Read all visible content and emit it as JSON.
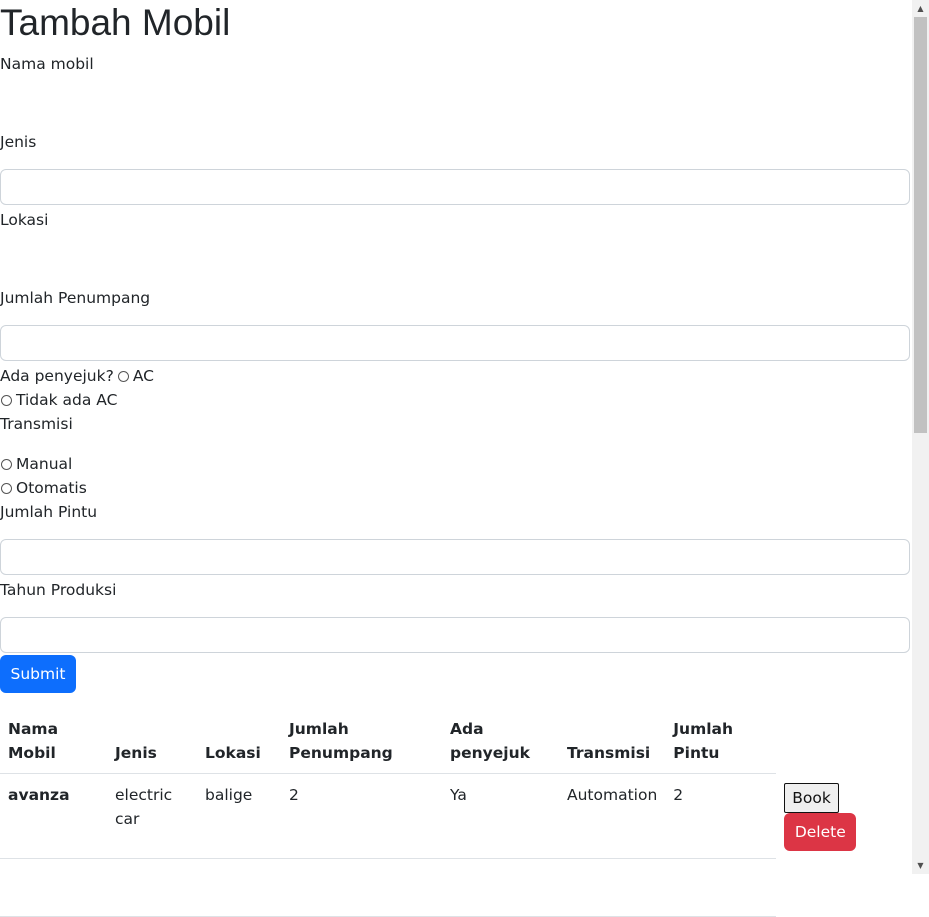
{
  "page": {
    "title": "Tambah Mobil"
  },
  "form": {
    "nama_label": "Nama mobil",
    "jenis_label": "Jenis",
    "lokasi_label": "Lokasi",
    "penumpang_label": "Jumlah Penumpang",
    "ac_label": "Ada penyejuk?",
    "ac_option_yes": "AC",
    "ac_option_no": "Tidak ada AC",
    "transmisi_label": "Transmisi",
    "trans_manual": "Manual",
    "trans_otomatis": "Otomatis",
    "pintu_label": "Jumlah Pintu",
    "tahun_label": "Tahun Produksi",
    "submit_label": "Submit"
  },
  "table": {
    "headers": {
      "nama_1": "Nama",
      "nama_2": "Mobil",
      "jenis": "Jenis",
      "lokasi": "Lokasi",
      "penumpang_1": "Jumlah",
      "penumpang_2": "Penumpang",
      "ac_1": "Ada",
      "ac_2": "penyejuk",
      "transmisi": "Transmisi",
      "pintu_1": "Jumlah",
      "pintu_2": "Pintu"
    },
    "rows": [
      {
        "nama": "avanza",
        "jenis_1": "electric",
        "jenis_2": "car",
        "lokasi": "balige",
        "penumpang": "2",
        "ac": "Ya",
        "transmisi": "Automation",
        "pintu": "2",
        "book_label": "Book",
        "delete_label": "Delete"
      }
    ]
  },
  "colors": {
    "primary": "#0d6efd",
    "danger": "#dc3545"
  },
  "icons": {
    "scroll_up": "triangle-up-icon",
    "scroll_down": "triangle-down-icon"
  }
}
